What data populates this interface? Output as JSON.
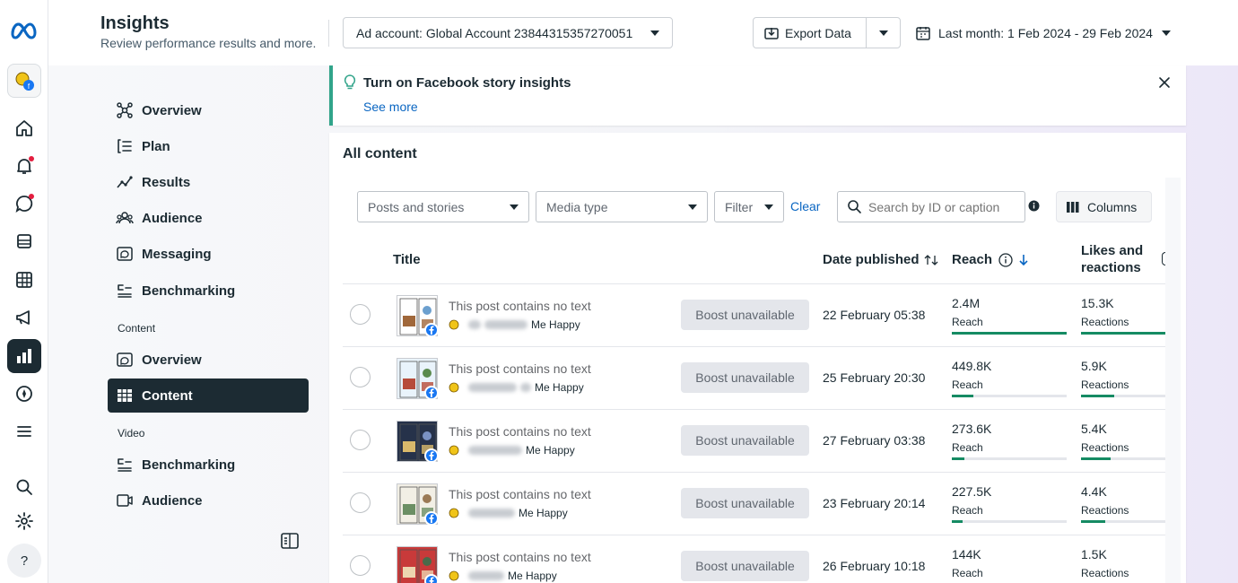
{
  "header": {
    "title": "Insights",
    "subtitle": "Review performance results and more.",
    "ad_account": "Ad account: Global Account 23844315357270051",
    "export_label": "Export Data",
    "date_range": "Last month: 1 Feb 2024 - 29 Feb 2024"
  },
  "sidebar": {
    "primary": [
      {
        "label": "Overview",
        "icon": "overview-icon"
      },
      {
        "label": "Plan",
        "icon": "plan-icon"
      },
      {
        "label": "Results",
        "icon": "results-icon"
      },
      {
        "label": "Audience",
        "icon": "audience-icon"
      },
      {
        "label": "Messaging",
        "icon": "messaging-icon"
      },
      {
        "label": "Benchmarking",
        "icon": "benchmarking-icon"
      }
    ],
    "content_section": "Content",
    "content_items": [
      {
        "label": "Overview",
        "icon": "overview-icon"
      },
      {
        "label": "Content",
        "icon": "table-icon",
        "active": true
      }
    ],
    "video_section": "Video",
    "video_items": [
      {
        "label": "Benchmarking",
        "icon": "benchmarking-icon"
      },
      {
        "label": "Audience",
        "icon": "video-icon"
      }
    ]
  },
  "banner": {
    "title": "Turn on Facebook story insights",
    "link": "See more"
  },
  "content": {
    "title": "All content",
    "filters": {
      "posts_select": "Posts and stories",
      "media_select": "Media type",
      "filter_select": "Filter",
      "clear": "Clear",
      "search_placeholder": "Search by ID or caption",
      "columns_label": "Columns"
    },
    "columns": {
      "title": "Title",
      "date": "Date published",
      "reach": "Reach",
      "likes": "Likes and reactions"
    },
    "rows": [
      {
        "text": "This post contains no text",
        "page_suffix": "Me Happy",
        "boost": "Boost unavailable",
        "date": "22 February 05:38",
        "reach": "2.4M",
        "reach_label": "Reach",
        "reach_frac": 1.0,
        "reactions": "15.3K",
        "reactions_label": "Reactions",
        "reactions_frac": 1.0
      },
      {
        "text": "This post contains no text",
        "page_suffix": "Me Happy",
        "boost": "Boost unavailable",
        "date": "25 February 20:30",
        "reach": "449.8K",
        "reach_label": "Reach",
        "reach_frac": 0.19,
        "reactions": "5.9K",
        "reactions_label": "Reactions",
        "reactions_frac": 0.39
      },
      {
        "text": "This post contains no text",
        "page_suffix": "Me Happy",
        "boost": "Boost unavailable",
        "date": "27 February 03:38",
        "reach": "273.6K",
        "reach_label": "Reach",
        "reach_frac": 0.11,
        "reactions": "5.4K",
        "reactions_label": "Reactions",
        "reactions_frac": 0.35
      },
      {
        "text": "This post contains no text",
        "page_suffix": "Me Happy",
        "boost": "Boost unavailable",
        "date": "23 February 20:14",
        "reach": "227.5K",
        "reach_label": "Reach",
        "reach_frac": 0.09,
        "reactions": "4.4K",
        "reactions_label": "Reactions",
        "reactions_frac": 0.29
      },
      {
        "text": "This post contains no text",
        "page_suffix": "Me Happy",
        "boost": "Boost unavailable",
        "date": "26 February 10:18",
        "reach": "144K",
        "reach_label": "Reach",
        "reach_frac": 0.06,
        "reactions": "1.5K",
        "reactions_label": "Reactions",
        "reactions_frac": 0.1
      }
    ]
  },
  "colors": {
    "brand_blue": "#0a66c2",
    "accent_green": "#158b63",
    "banner_accent": "#31a48a",
    "nav_active": "#1c2b33"
  }
}
